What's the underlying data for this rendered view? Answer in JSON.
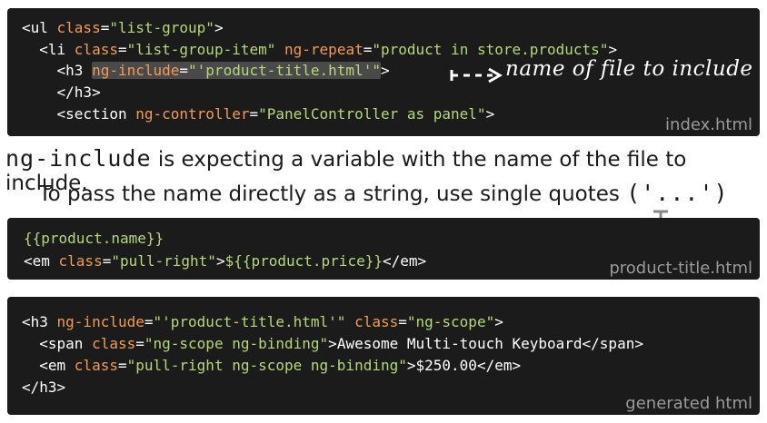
{
  "index_block": {
    "lines": [
      [
        "<ul ",
        "class",
        "=",
        "\"list-group\"",
        ">"
      ],
      [
        "  <li ",
        "class",
        "=",
        "\"list-group-item\"",
        " ",
        "ng-repeat",
        "=",
        "\"product in store.products\"",
        ">"
      ],
      [
        "    <h3 ",
        "ng-include",
        "=",
        "\"'product-title.html'\"",
        ">"
      ],
      [
        "    </h3>"
      ],
      [
        "    <section ",
        "ng-controller",
        "=",
        "\"PanelController as panel\"",
        ">"
      ]
    ],
    "label": "index.html",
    "annotation": "name of file to include"
  },
  "caption": {
    "line1_code": "ng-include",
    "line1_text": " is expecting a variable with the name of the file to include.",
    "line2_text": "To pass the name directly as a string, use single quotes ",
    "line2_code": "('...')"
  },
  "product_title_block": {
    "line1": "{{product.name}}",
    "line2_open": "<em ",
    "line2_attr": "class",
    "line2_eq": "=",
    "line2_val": "\"pull-right\"",
    "line2_close": ">",
    "line2_content": "${{product.price}}",
    "line2_end": "</em>",
    "label": "product-title.html"
  },
  "generated_block": {
    "l1_open": "<h3 ",
    "l1_attr1": "ng-include",
    "l1_eq": "=",
    "l1_val1": "\"'product-title.html'\"",
    "l1_sp": " ",
    "l1_attr2": "class",
    "l1_val2": "\"ng-scope\"",
    "l1_close": ">",
    "l2_open": "  <span ",
    "l2_attr": "class",
    "l2_val": "\"ng-scope ng-binding\"",
    "l2_content": "Awesome Multi-touch Keyboard",
    "l2_end": "</span>",
    "l3_open": "  <em ",
    "l3_attr": "class",
    "l3_val": "\"pull-right ng-scope ng-binding\"",
    "l3_content": "$250.00",
    "l3_end": "</em>",
    "l4": "</h3>",
    "label": "generated html"
  },
  "colors": {
    "block_bg": "#1b1b1b",
    "string": "#b5d87a",
    "attribute": "#f29b55",
    "label": "#9a9a9a"
  }
}
